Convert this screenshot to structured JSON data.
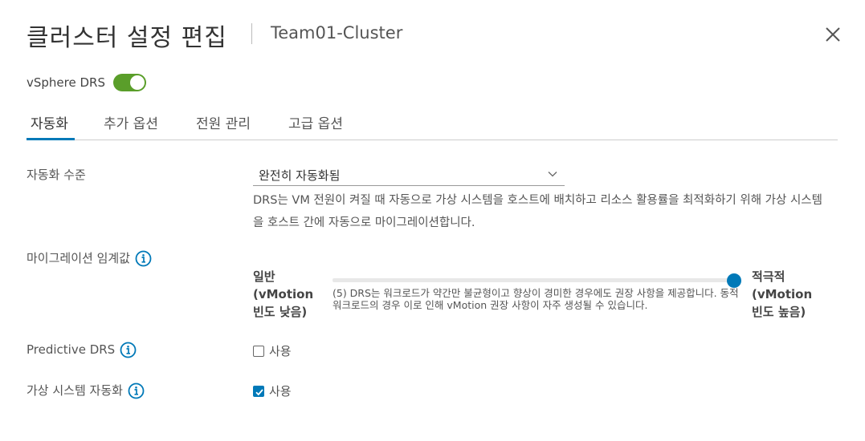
{
  "dialog": {
    "title": "클러스터 설정 편집",
    "subtitle": "Team01-Cluster"
  },
  "drs": {
    "label": "vSphere DRS",
    "enabled": true
  },
  "tabs": [
    {
      "label": "자동화",
      "active": true
    },
    {
      "label": "추가 옵션",
      "active": false
    },
    {
      "label": "전원 관리",
      "active": false
    },
    {
      "label": "고급 옵션",
      "active": false
    }
  ],
  "automation": {
    "label": "자동화 수준",
    "selected": "완전히 자동화됨",
    "description": "DRS는 VM 전원이 켜질 때 자동으로 가상 시스템을 호스트에 배치하고 리소스 활용률을 최적화하기 위해 가상 시스템을 호스트 간에 자동으로 마이그레이션합니다."
  },
  "migration": {
    "label": "마이그레이션 임계값",
    "left_label_1": "일반",
    "left_label_2": "(vMotion",
    "left_label_3": "빈도 낮음)",
    "right_label_1": "적극적",
    "right_label_2": "(vMotion",
    "right_label_3": "빈도 높음)",
    "level": 5,
    "max_level": 5,
    "description": "(5) DRS는 워크로드가 약간만 불균형이고 향상이 경미한 경우에도 권장 사항을 제공합니다. 동적 워크로드의 경우 이로 인해 vMotion 권장 사항이 자주 생성될 수 있습니다."
  },
  "predictive": {
    "label": "Predictive DRS",
    "checkbox_label": "사용",
    "checked": false
  },
  "vm_automation": {
    "label": "가상 시스템 자동화",
    "checkbox_label": "사용",
    "checked": true
  },
  "icons": {
    "close": "close-icon",
    "info": "info-circle-icon",
    "chevron": "chevron-down-icon"
  },
  "colors": {
    "accent": "#0079b8",
    "toggle_on": "#5a9e2a"
  }
}
